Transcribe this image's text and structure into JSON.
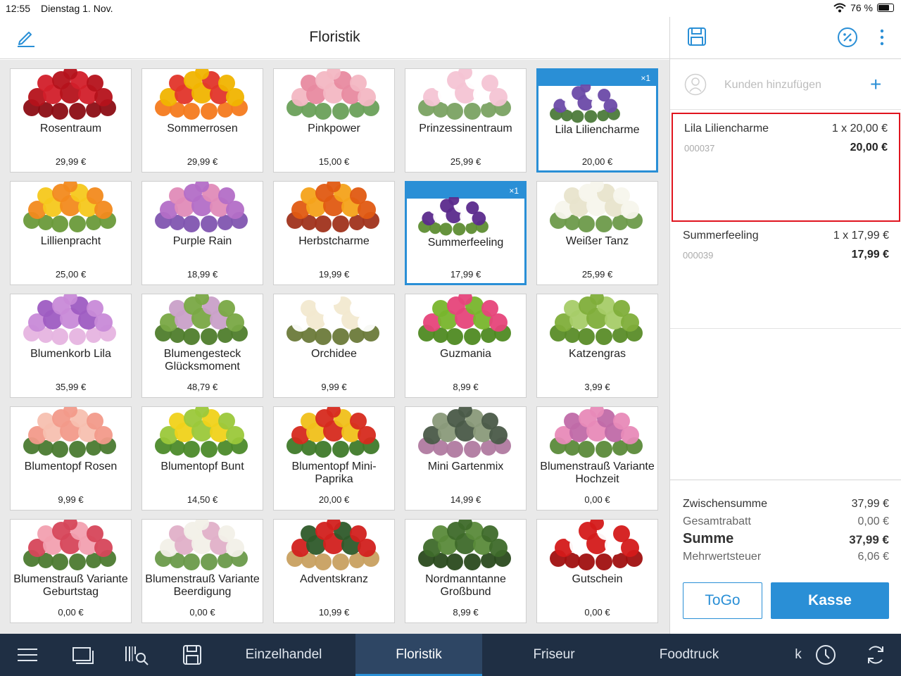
{
  "status": {
    "time": "12:55",
    "date": "Dienstag 1. Nov.",
    "battery": "76 %"
  },
  "header": {
    "title": "Floristik"
  },
  "products": [
    {
      "name": "Rosentraum",
      "price": "29,99 €",
      "colors": [
        "#b5121b",
        "#d21f2a",
        "#8c0d14"
      ]
    },
    {
      "name": "Sommerrosen",
      "price": "29,99 €",
      "colors": [
        "#f0b400",
        "#e2352a",
        "#f47a1e"
      ]
    },
    {
      "name": "Pinkpower",
      "price": "15,00 €",
      "colors": [
        "#f3b7c3",
        "#e88aa0",
        "#6aa05a"
      ]
    },
    {
      "name": "Prinzessinentraum",
      "price": "25,99 €",
      "colors": [
        "#f4c4d4",
        "#ffffff",
        "#7aa262"
      ]
    },
    {
      "name": "Lila Liliencharme",
      "price": "20,00 €",
      "colors": [
        "#6b4aa8",
        "#ffffff",
        "#4c7a3a"
      ],
      "badge": "×1"
    },
    {
      "name": "Lillienpracht",
      "price": "25,00 €",
      "colors": [
        "#f28a1e",
        "#f5c81c",
        "#6a9a3a"
      ]
    },
    {
      "name": "Purple Rain",
      "price": "18,99 €",
      "colors": [
        "#b36ec7",
        "#e08bb8",
        "#8155b0"
      ]
    },
    {
      "name": "Herbstcharme",
      "price": "19,99 €",
      "colors": [
        "#e05a12",
        "#f4a21a",
        "#a0331c"
      ]
    },
    {
      "name": "Summerfeeling",
      "price": "17,99 €",
      "colors": [
        "#5b2a8c",
        "#ffffff",
        "#5e8d33"
      ],
      "badge": "×1"
    },
    {
      "name": "Weißer Tanz",
      "price": "25,99 €",
      "colors": [
        "#f7f6ec",
        "#e8e4cc",
        "#6d9a4a"
      ]
    },
    {
      "name": "Blumenkorb Lila",
      "price": "35,99 €",
      "colors": [
        "#c88ad8",
        "#9e5cc2",
        "#e6b4e0"
      ]
    },
    {
      "name": "Blumengesteck Glücksmoment",
      "price": "48,79 €",
      "colors": [
        "#79a844",
        "#c9a0c8",
        "#4f7d2c"
      ]
    },
    {
      "name": "Orchidee",
      "price": "9,99 €",
      "colors": [
        "#ffffff",
        "#f2e9d0",
        "#6b7a3a"
      ]
    },
    {
      "name": "Guzmania",
      "price": "8,99 €",
      "colors": [
        "#e6457a",
        "#78b52c",
        "#4f8a22"
      ]
    },
    {
      "name": "Katzengras",
      "price": "3,99 €",
      "colors": [
        "#7fae3a",
        "#a7cc68",
        "#5a8c28"
      ]
    },
    {
      "name": "Blumentopf Rosen",
      "price": "9,99 €",
      "colors": [
        "#f29a8a",
        "#f7c0b0",
        "#4a7a30"
      ]
    },
    {
      "name": "Blumentopf Bunt",
      "price": "14,50 €",
      "colors": [
        "#9bc83a",
        "#f0d21a",
        "#4c8a2a"
      ]
    },
    {
      "name": "Blumentopf Mini-Paprika",
      "price": "20,00 €",
      "colors": [
        "#d62a1e",
        "#f0c01a",
        "#3f7a2a"
      ]
    },
    {
      "name": "Mini Gartenmix",
      "price": "14,99 €",
      "colors": [
        "#4a5a48",
        "#8a9a7a",
        "#b07aa0"
      ]
    },
    {
      "name": "Blumenstrauß Variante Hochzeit",
      "price": "0,00 €",
      "colors": [
        "#e88ab8",
        "#c06aa8",
        "#5b8a3a"
      ]
    },
    {
      "name": "Blumenstrauß Variante Geburtstag",
      "price": "0,00 €",
      "colors": [
        "#d6465a",
        "#f2a0b0",
        "#4c7a30"
      ]
    },
    {
      "name": "Blumenstrauß Variante Beerdigung",
      "price": "0,00 €",
      "colors": [
        "#f2f0e8",
        "#e0b0c8",
        "#6a9a4a"
      ]
    },
    {
      "name": "Adventskranz",
      "price": "10,99 €",
      "colors": [
        "#d2201e",
        "#2e5a2a",
        "#c8a060"
      ]
    },
    {
      "name": "Nordmanntanne Großbund",
      "price": "8,99 €",
      "colors": [
        "#3e6a2a",
        "#5a8a3a",
        "#2a4a1e"
      ]
    },
    {
      "name": "Gutschein",
      "price": "0,00 €",
      "colors": [
        "#d41a1a",
        "#ffffff",
        "#a01010"
      ]
    }
  ],
  "customer": {
    "placeholder": "Kunden hinzufügen"
  },
  "cart": [
    {
      "name": "Lila Liliencharme",
      "qty": "1 x 20,00 €",
      "sku": "000037",
      "total": "20,00 €"
    },
    {
      "name": "Summerfeeling",
      "qty": "1 x 17,99 €",
      "sku": "000039",
      "total": "17,99 €"
    }
  ],
  "totals": {
    "subtotal_label": "Zwischensumme",
    "subtotal": "37,99 €",
    "discount_label": "Gesamtrabatt",
    "discount": "0,00 €",
    "sum_label": "Summe",
    "sum": "37,99 €",
    "tax_label": "Mehrwertsteuer",
    "tax": "6,06 €"
  },
  "buttons": {
    "togo": "ToGo",
    "kasse": "Kasse"
  },
  "tabs": [
    {
      "label": "Einzelhandel"
    },
    {
      "label": "Floristik",
      "active": true
    },
    {
      "label": "Friseur"
    },
    {
      "label": "Foodtruck"
    },
    {
      "label": "k"
    }
  ],
  "accent_color": "#2a8fd6",
  "highlight_color": "#e0141e"
}
